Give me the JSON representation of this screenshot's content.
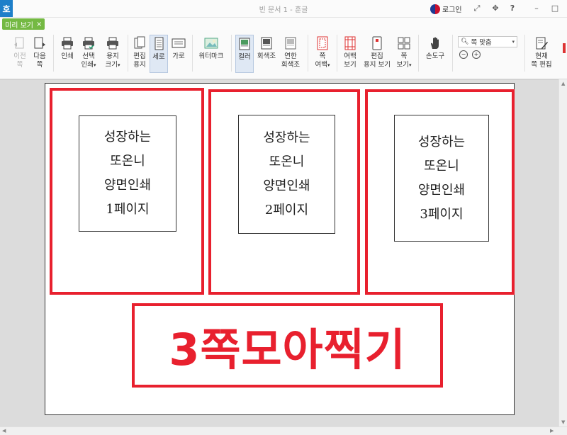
{
  "window": {
    "logo": "호",
    "title": "빈 문서 1 - 훈글",
    "login": "로그인",
    "icons": [
      "expand-icon",
      "move-icon",
      "help-icon",
      "minimize-icon",
      "maximize-icon"
    ],
    "help": "?"
  },
  "tab": {
    "label": "미리 보기",
    "close": "×"
  },
  "ribbon": {
    "prev_page": [
      "이전",
      "쪽"
    ],
    "next_page": [
      "다음",
      "쪽"
    ],
    "print": "인쇄",
    "select_print": [
      "선택",
      "인쇄"
    ],
    "paper_size": [
      "용지",
      "크기"
    ],
    "edit_paper": [
      "편집",
      "용지"
    ],
    "portrait": "세로",
    "landscape": "가로",
    "watermark": "워터마크",
    "color": "컬러",
    "grayscale": "회색조",
    "light_grayscale": [
      "연한",
      "회색조"
    ],
    "page_margin": [
      "쪽",
      "여백"
    ],
    "margin_view": [
      "여백",
      "보기"
    ],
    "edit_paper_view": [
      "편집",
      "용지 보기"
    ],
    "page_view": [
      "쪽",
      "보기"
    ],
    "hand_tool": "손도구",
    "zoom_select": "쪽 맞춤",
    "current_page_edit": [
      "현재",
      "쪽 편집"
    ]
  },
  "preview": {
    "pages": [
      {
        "lines": [
          "성장하는",
          "또온니",
          "양면인쇄",
          "1페이지"
        ]
      },
      {
        "lines": [
          "성장하는",
          "또온니",
          "양면인쇄",
          "2페이지"
        ]
      },
      {
        "lines": [
          "성장하는",
          "또온니",
          "양면인쇄",
          "3페이지"
        ]
      }
    ],
    "caption": "3쪽모아찍기"
  },
  "colors": {
    "accent_red": "#e8202e",
    "tab_green": "#74b943",
    "logo_blue": "#1e7fc9"
  }
}
